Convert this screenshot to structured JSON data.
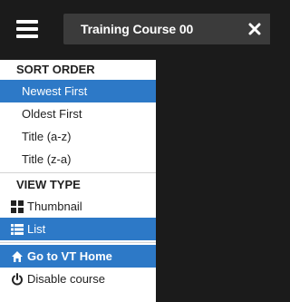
{
  "header": {
    "menu_icon": "hamburger-menu-icon",
    "course_title": "Training Course 00",
    "close_icon": "close-x-icon"
  },
  "menu": {
    "sort_order": {
      "heading": "SORT ORDER",
      "options": [
        "Newest First",
        "Oldest First",
        "Title (a-z)",
        "Title (z-a)"
      ],
      "selected": "Newest First"
    },
    "view_type": {
      "heading": "VIEW TYPE",
      "options": [
        {
          "label": "Thumbnail",
          "icon": "grid-icon"
        },
        {
          "label": "List",
          "icon": "list-icon"
        }
      ],
      "selected": "List"
    },
    "actions": [
      {
        "label": "Go to VT Home",
        "icon": "home-icon"
      },
      {
        "label": "Disable course",
        "icon": "power-icon"
      }
    ]
  },
  "colors": {
    "accent": "#2d79c7",
    "background": "#1b1b1b",
    "tab": "#3b3b3b"
  }
}
